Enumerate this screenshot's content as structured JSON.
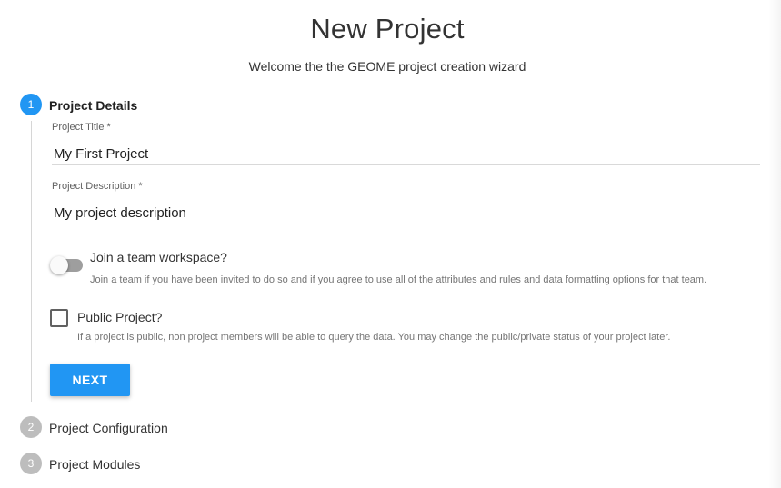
{
  "header": {
    "title": "New Project",
    "subtitle": "Welcome the the GEOME project creation wizard"
  },
  "steps": [
    {
      "number": "1",
      "label": "Project Details",
      "state": "active"
    },
    {
      "number": "2",
      "label": "Project Configuration",
      "state": "inactive"
    },
    {
      "number": "3",
      "label": "Project Modules",
      "state": "inactive"
    }
  ],
  "form": {
    "title_label": "Project Title *",
    "title_value": "My First Project",
    "description_label": "Project Description *",
    "description_value": "My project description",
    "team_toggle": {
      "label": "Join a team workspace?",
      "help": "Join a team if you have been invited to do so and if you agree to use all of the attributes and rules and data formatting options for that team.",
      "checked": false
    },
    "public_checkbox": {
      "label": "Public Project?",
      "help": "If a project is public, non project members will be able to query the data. You may change the public/private status of your project later.",
      "checked": false
    },
    "next_label": "NEXT"
  },
  "colors": {
    "accent": "#2196f3",
    "inactive_step": "#bdbdbd"
  }
}
